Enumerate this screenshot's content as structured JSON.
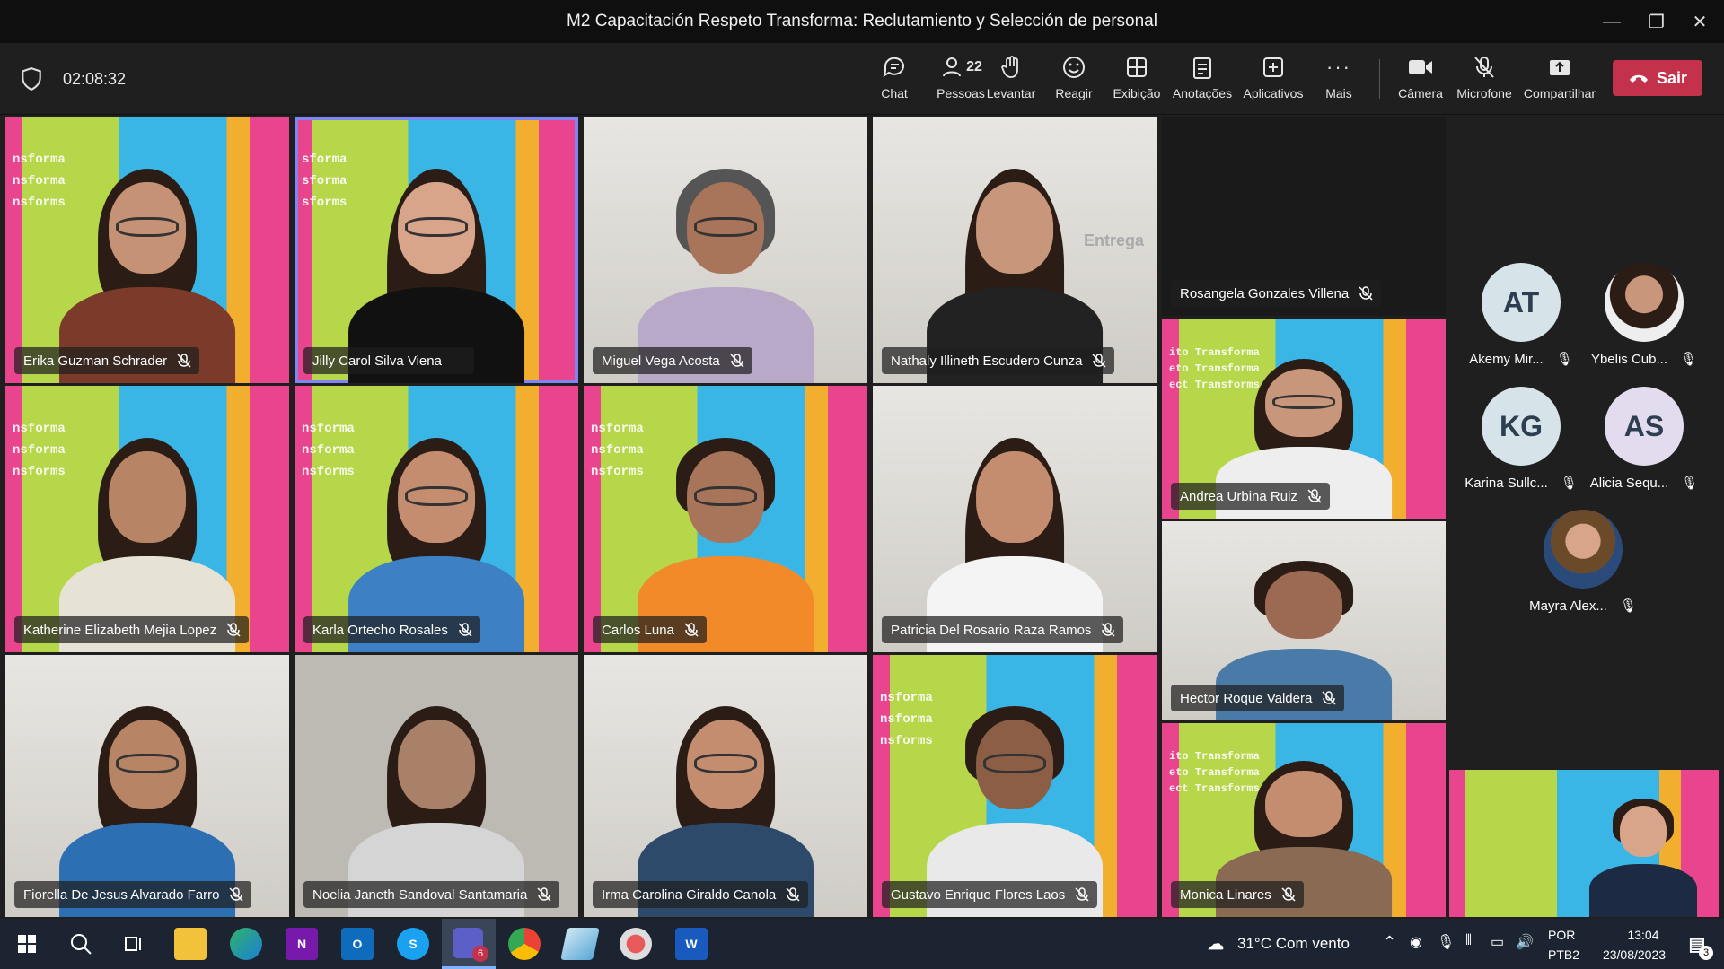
{
  "window": {
    "title": "M2 Capacitación Respeto Transforma: Reclutamiento y Selección de personal"
  },
  "meeting": {
    "timer": "02:08:32"
  },
  "toolbar": {
    "chat": "Chat",
    "people": "Pessoas",
    "people_count": "22",
    "raise": "Levantar",
    "react": "Reagir",
    "view": "Exibição",
    "notes": "Anotações",
    "apps": "Aplicativos",
    "more": "Mais",
    "camera": "Câmera",
    "mic": "Microfone",
    "share": "Compartilhar",
    "leave": "Sair"
  },
  "participants": {
    "p1": "Erika Guzman Schrader",
    "p2": "Jilly Carol Silva Viena",
    "p3": "Miguel Vega Acosta",
    "p4": "Nathaly Illineth Escudero Cunza",
    "p5": "Rosangela Gonzales Villena",
    "p6": "Katherine Elizabeth Mejia Lopez",
    "p7": "Karla Ortecho Rosales",
    "p8": "Carlos Luna",
    "p9": "Patricia Del Rosario Raza Ramos",
    "p10": "Andrea Urbina Ruiz",
    "p11": "Fiorella De Jesus Alvarado Farro",
    "p12": "Noelia Janeth Sandoval Santamaria",
    "p13": "Irma Carolina Giraldo Canola",
    "p14": "Gustavo Enrique Flores Laos",
    "p15": "Hector Roque Valdera",
    "p16": "Monica Linares"
  },
  "bg_text": {
    "a": "nsforma",
    "b": "sforma",
    "c": "sforms",
    "d": "ito Transforma",
    "e": "eto Transforma",
    "f": "ect Transforms",
    "g": "nsforms",
    "entrega": "Entrega"
  },
  "roster": {
    "r1_initials": "AT",
    "r1_name": "Akemy Mir...",
    "r2_name": "Ybelis Cub...",
    "r3_initials": "KG",
    "r3_name": "Karina Sullc...",
    "r4_initials": "AS",
    "r4_name": "Alicia Sequ...",
    "r5_name": "Mayra Alex..."
  },
  "taskbar": {
    "weather": "31°C  Com vento",
    "lang": "POR",
    "layout": "PTB2",
    "time": "13:04",
    "date": "23/08/2023",
    "teams_badge": "6",
    "notif_badge": "3",
    "onenote": "N",
    "outlook": "O",
    "skype": "S",
    "word": "W"
  },
  "colors": {
    "leave": "#c4314b",
    "active_outline": "#7f85f5",
    "accent_avatar": "#d6e4ea"
  }
}
